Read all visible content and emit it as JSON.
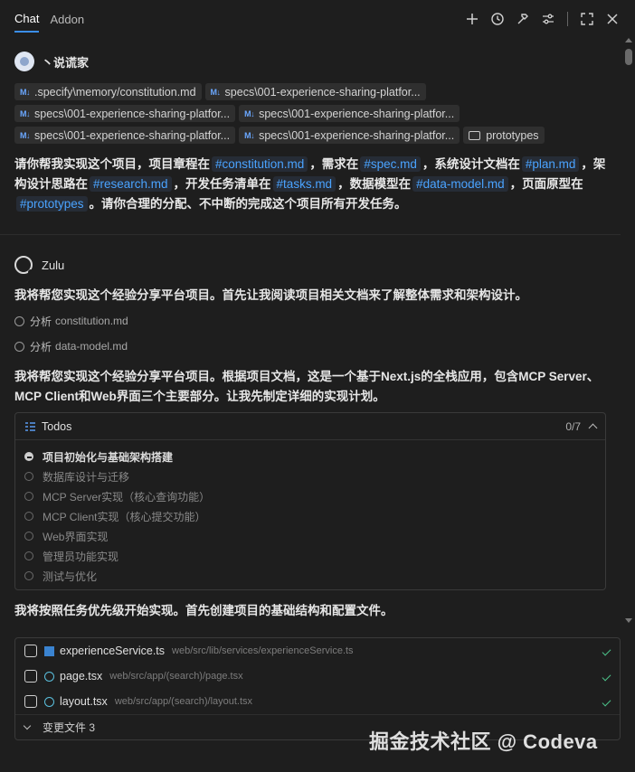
{
  "tabs": [
    {
      "label": "Chat",
      "active": true
    },
    {
      "label": "Addon",
      "active": false
    }
  ],
  "toolbar_icons": [
    "plus-icon",
    "history-icon",
    "hammer-icon",
    "sliders-icon",
    "expand-icon",
    "close-icon"
  ],
  "user": {
    "name": "丶说谎家",
    "chips": [
      {
        "type": "md",
        "label": ".specify\\memory/constitution.md"
      },
      {
        "type": "md",
        "label": "specs\\001-experience-sharing-platfor..."
      },
      {
        "type": "md",
        "label": "specs\\001-experience-sharing-platfor..."
      },
      {
        "type": "md",
        "label": "specs\\001-experience-sharing-platfor..."
      },
      {
        "type": "md",
        "label": "specs\\001-experience-sharing-platfor..."
      },
      {
        "type": "md",
        "label": "specs\\001-experience-sharing-platfor..."
      },
      {
        "type": "folder",
        "label": "prototypes"
      }
    ],
    "message": {
      "p1": "请你帮我实现这个项目，项目章程在",
      "r1": "#constitution.md",
      "p2": "，需求在",
      "r2": "#spec.md",
      "p3": "，系统设计文档在",
      "r3": "#plan.md",
      "p4": "，架构设计思路在",
      "r4": "#research.md",
      "p5": "，开发任务清单在",
      "r5": "#tasks.md",
      "p6": "，数据模型在",
      "r6": "#data-model.md",
      "p7": "，页面原型在",
      "r7": "#prototypes",
      "p8": "。请你合理的分配、不中断的完成这个项目所有开发任务。"
    }
  },
  "assistant": {
    "name": "Zulu",
    "intro": "我将帮您实现这个经验分享平台项目。首先让我阅读项目相关文档来了解整体需求和架构设计。",
    "steps": [
      {
        "verb": "分析",
        "file": "constitution.md"
      },
      {
        "verb": "分析",
        "file": "data-model.md"
      }
    ],
    "plan_text": "我将帮您实现这个经验分享平台项目。根据项目文档，这是一个基于Next.js的全栈应用，包含MCP Server、MCP Client和Web界面三个主要部分。让我先制定详细的实现计划。",
    "todos": {
      "title": "Todos",
      "count": "0/7",
      "items": [
        {
          "label": "项目初始化与基础架构搭建",
          "status": "in-progress"
        },
        {
          "label": "数据库设计与迁移",
          "status": "pending"
        },
        {
          "label": "MCP Server实现（核心查询功能）",
          "status": "pending"
        },
        {
          "label": "MCP Client实现（核心提交功能）",
          "status": "pending"
        },
        {
          "label": "Web界面实现",
          "status": "pending"
        },
        {
          "label": "管理员功能实现",
          "status": "pending"
        },
        {
          "label": "测试与优化",
          "status": "pending"
        }
      ]
    },
    "followup": "我将按照任务优先级开始实现。首先创建项目的基础结构和配置文件。",
    "files": [
      {
        "name": "experienceService.ts",
        "path": "web/src/lib/services/experienceService.ts",
        "kind": "ts"
      },
      {
        "name": "page.tsx",
        "path": "web/src/app/(search)/page.tsx",
        "kind": "react"
      },
      {
        "name": "layout.tsx",
        "path": "web/src/app/(search)/layout.tsx",
        "kind": "react"
      }
    ],
    "changed_files": "变更文件 3"
  },
  "watermark": "掘金技术社区 @ Codeva",
  "colors": {
    "accent": "#3b8eea",
    "link": "#4aa3ff",
    "success": "#4cc38a",
    "background": "#1e1e1e"
  }
}
